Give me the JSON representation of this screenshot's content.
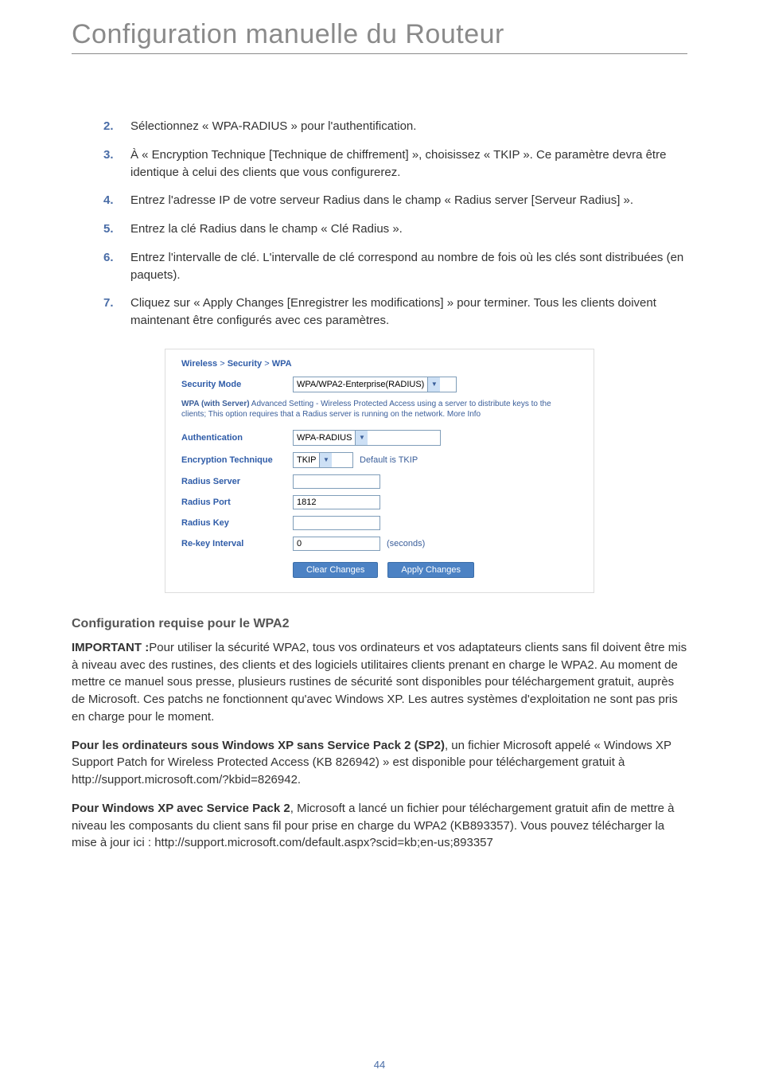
{
  "title": "Configuration manuelle du Routeur",
  "steps": [
    {
      "num": "2.",
      "text": "Sélectionnez « WPA-RADIUS » pour l'authentification."
    },
    {
      "num": "3.",
      "text": "À « Encryption Technique [Technique de chiffrement] », choisissez « TKIP ». Ce paramètre devra être identique à celui des clients que vous configurerez."
    },
    {
      "num": "4.",
      "text": "Entrez l'adresse IP de votre serveur Radius dans le champ « Radius server [Serveur Radius] »."
    },
    {
      "num": "5.",
      "text": "Entrez la clé Radius dans le champ « Clé Radius »."
    },
    {
      "num": "6.",
      "text": "Entrez l'intervalle de clé. L'intervalle de clé correspond au nombre de fois où les clés sont distribuées (en paquets)."
    },
    {
      "num": "7.",
      "text": "Cliquez sur « Apply Changes [Enregistrer les modifications] » pour terminer. Tous les clients doivent maintenant être configurés avec ces paramètres."
    }
  ],
  "ui": {
    "crumb": {
      "a": "Wireless",
      "b": "Security",
      "c": "WPA",
      "sep": ">"
    },
    "security_mode_label": "Security Mode",
    "security_mode_value": "WPA/WPA2-Enterprise(RADIUS)",
    "note_bold": "WPA (with Server)",
    "note_rest": " Advanced Setting - Wireless Protected Access using a server to distribute keys to the clients; This option requires that a Radius server is running on the network. More Info",
    "auth_label": "Authentication",
    "auth_value": "WPA-RADIUS",
    "enc_label": "Encryption Technique",
    "enc_value": "TKIP",
    "enc_hint": "Default is TKIP",
    "radius_server_label": "Radius Server",
    "radius_server_value": "",
    "radius_port_label": "Radius Port",
    "radius_port_value": "1812",
    "radius_key_label": "Radius Key",
    "radius_key_value": "",
    "rekey_label": "Re-key Interval",
    "rekey_value": "0",
    "rekey_unit": "(seconds)",
    "btn_clear": "Clear Changes",
    "btn_apply": "Apply Changes"
  },
  "heading_wpa2": "Configuration requise pour le WPA2",
  "para_important_label": "IMPORTANT :",
  "para_important": "Pour utiliser la sécurité WPA2, tous vos ordinateurs et vos adaptateurs clients sans fil doivent être mis à niveau avec des rustines, des clients et des logiciels utilitaires clients prenant en charge le WPA2. Au moment de mettre ce manuel sous presse, plusieurs rustines de sécurité sont disponibles pour téléchargement gratuit, auprès de Microsoft. Ces patchs ne fonctionnent qu'avec Windows XP. Les autres systèmes d'exploitation ne sont pas pris en charge pour le moment.",
  "para_sp2_label": "Pour les ordinateurs sous Windows XP sans Service Pack 2 (SP2)",
  "para_sp2": ", un fichier Microsoft appelé « Windows XP Support Patch for Wireless Protected Access (KB 826942) » est disponible pour téléchargement gratuit à http://support.microsoft.com/?kbid=826942.",
  "para_sp2b_label": "Pour Windows XP avec Service Pack 2",
  "para_sp2b": ", Microsoft a lancé un fichier pour téléchargement gratuit afin de mettre à niveau les composants du client sans fil pour prise en charge du WPA2 (KB893357). Vous pouvez télécharger la mise à jour ici :  http://support.microsoft.com/default.aspx?scid=kb;en-us;893357",
  "page_number": "44"
}
